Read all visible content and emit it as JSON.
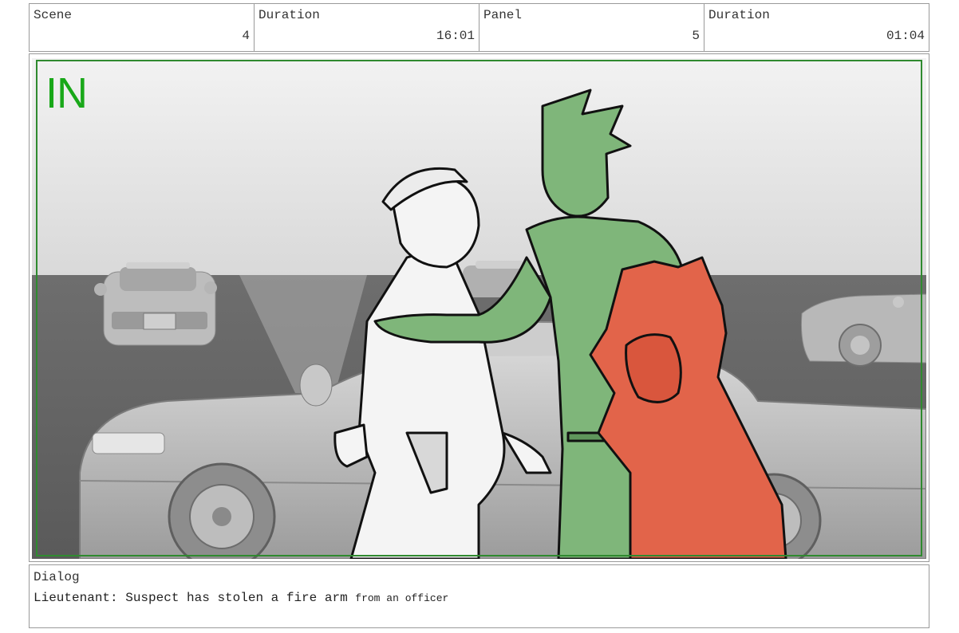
{
  "header": {
    "cells": [
      {
        "label": "Scene",
        "value": "4"
      },
      {
        "label": "Duration",
        "value": "16:01"
      },
      {
        "label": "Panel",
        "value": "5"
      },
      {
        "label": "Duration",
        "value": "01:04"
      }
    ]
  },
  "panel": {
    "marker": "IN",
    "marker_color": "#19a819",
    "safe_frame_color": "#2f8a2f",
    "character_colors": {
      "officer": "#f4f4f4",
      "green_character": "#7fb67a",
      "red_character": "#e2644a"
    }
  },
  "dialog": {
    "label": "Dialog",
    "line_main": "Lieutenant: Suspect has stolen a fire arm",
    "line_tail": "from an officer"
  }
}
